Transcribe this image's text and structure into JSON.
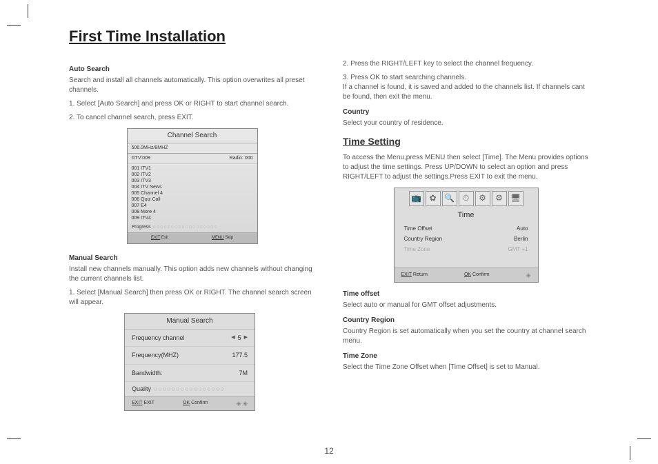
{
  "page_title": "First Time Installation",
  "page_number": "12",
  "left": {
    "auto_search_h": "Auto Search",
    "auto_search_p1": "Search and install all channels automatically. This option overwrites all preset channels.",
    "auto_search_p2": "1. Select [Auto Search] and press OK or RIGHT to start channel search.",
    "auto_search_p3": "2. To cancel channel search, press EXIT.",
    "panel_title": "Channel Search",
    "panel_sub": "506.0MHz/8MHZ",
    "panel_dtv": "DTV:009",
    "panel_radio": "Radio: 000",
    "channels": [
      "001 ITV1",
      "002 ITV2",
      "003 ITV3",
      "004 ITV News",
      "005 Channel 4",
      "006 Quiz Call",
      "007 E4",
      "008 More 4",
      "009 ITV4"
    ],
    "panel_progress": "Progress",
    "panel_exit": "Exit",
    "panel_exit_btn": "EXIT",
    "panel_skip": "Skip",
    "panel_menu_btn": "MENU",
    "manual_h": "Manual Search",
    "manual_p1": "Install new channels  manually. This option adds new channels without changing the current channels list.",
    "manual_p2": "1. Select [Manual Search] then press OK or RIGHT. The channel search screen will appear.",
    "ms_title": "Manual Search",
    "ms_freq_ch_l": "Frequency channel",
    "ms_freq_ch_v": "5",
    "ms_freq_l": "Frequency(MHZ)",
    "ms_freq_v": "177.5",
    "ms_bw_l": "Bandwidth:",
    "ms_bw_v": "7M",
    "ms_quality": "Quality",
    "ms_exit_btn": "EXIT",
    "ms_exit": "EXIT",
    "ms_ok_btn": "OK",
    "ms_confirm": "Confirm"
  },
  "right": {
    "p1": "2. Press the RIGHT/LEFT key to select the channel frequency.",
    "p2": "3. Press OK to start searching channels.",
    "p3": "If a channel is found, it is saved and added to the channels list. If channels cant  be found, then exit the menu.",
    "country_h": "Country",
    "country_p": "Select your country of residence.",
    "time_title": "Time Setting",
    "time_intro": "To access the Menu,press MENU then select [Time]. The Menu provides options to adjust the time settings.      Press UP/DOWN to select an option and press RIGHT/LEFT to adjust the settings.Press EXIT to exit the menu.",
    "time_panel_title": "Time",
    "rows": [
      {
        "l": "Time Offset",
        "v": "Auto"
      },
      {
        "l": "Country Region",
        "v": "Berlin"
      },
      {
        "l": "Time Zone",
        "v": "GMT +1"
      }
    ],
    "time_exit_btn": "EXIT",
    "time_return": "Return",
    "time_ok_btn": "OK",
    "time_confirm": "Confirm",
    "time_offset_h": "Time offset",
    "time_offset_p": "Select auto or manual for GMT offset adjustments.",
    "cr_h": "Country Region",
    "cr_p": "Country Region is set automatically when you set the country at channel search menu.",
    "tz_h": "Time Zone",
    "tz_p": "Select the Time Zone Offset when [Time Offset] is set to Manual."
  },
  "icons": [
    "📺",
    "✿",
    "🔍",
    "⏱",
    "⚙",
    "⚙",
    "🖥"
  ]
}
